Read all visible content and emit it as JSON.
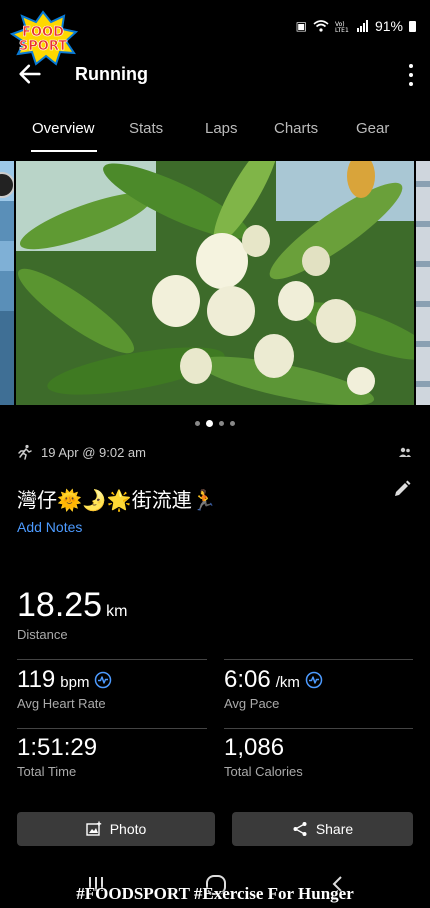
{
  "brand": {
    "logo_text": "FOODSPORT"
  },
  "status": {
    "battery": "91%",
    "icons": [
      "wifi-icon",
      "volte-icon",
      "signal-icon",
      "battery-icon"
    ]
  },
  "header": {
    "title": "Running"
  },
  "tabs": [
    {
      "label": "Overview",
      "active": true
    },
    {
      "label": "Stats"
    },
    {
      "label": "Laps"
    },
    {
      "label": "Charts"
    },
    {
      "label": "Gear"
    }
  ],
  "carousel": {
    "pages": 4,
    "active_page": 2
  },
  "activity": {
    "datetime": "19 Apr @ 9:02 am",
    "name": "灣仔🌞🌛🌟街流連🏃",
    "add_notes": "Add Notes"
  },
  "stats": {
    "distance": {
      "value": "18.25",
      "unit": "km",
      "label": "Distance"
    },
    "heart_rate": {
      "value": "119",
      "unit": "bpm",
      "label": "Avg Heart Rate"
    },
    "pace": {
      "value": "6:06",
      "unit": "/km",
      "label": "Avg Pace"
    },
    "time": {
      "value": "1:51:29",
      "label": "Total Time"
    },
    "calories": {
      "value": "1,086",
      "label": "Total Calories"
    }
  },
  "buttons": {
    "photo": "Photo",
    "share": "Share"
  },
  "watermark": "#FOODSPORT #Exercise For Hunger",
  "colors": {
    "accent": "#4d9bff",
    "background": "#000000",
    "button": "#3a3a3a"
  }
}
